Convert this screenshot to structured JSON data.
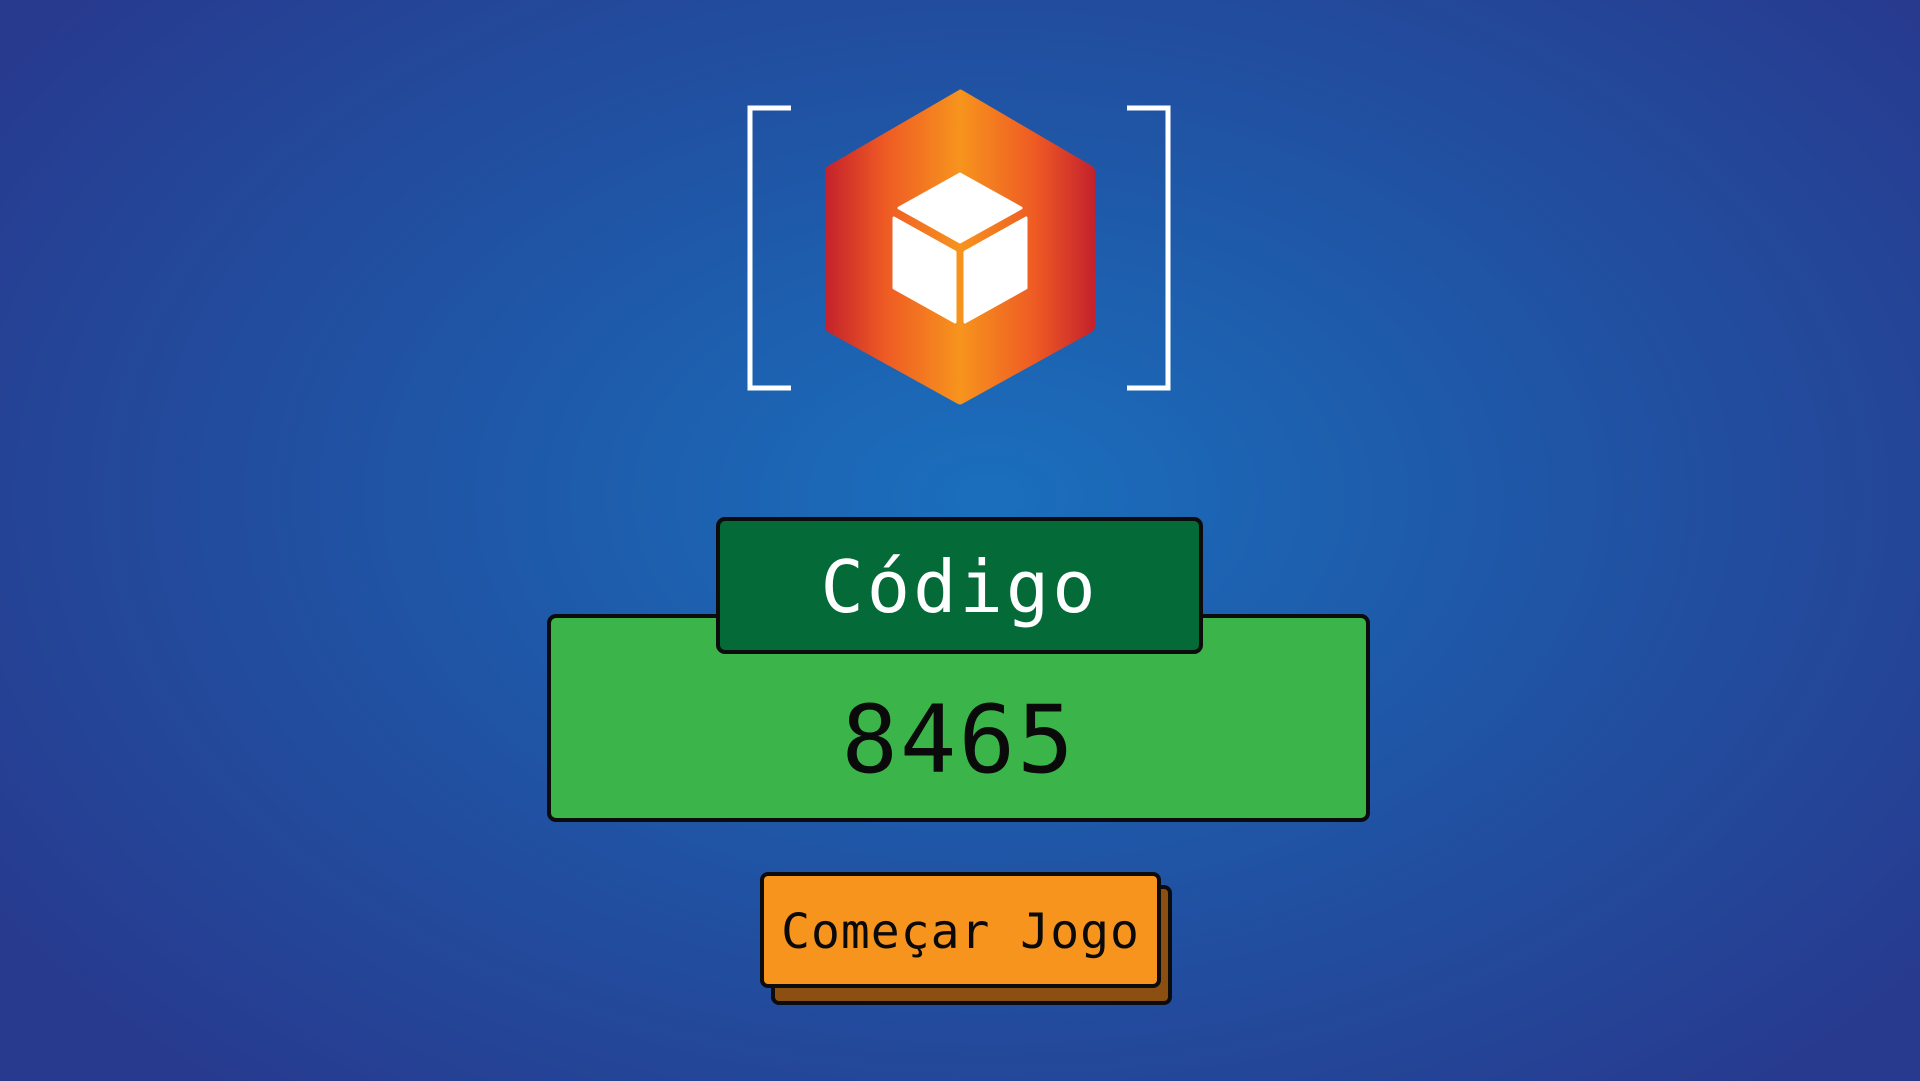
{
  "logo": {
    "icon": "cube-hexagon-icon",
    "colors": {
      "edge": "#c8232c",
      "mid": "#f26522",
      "center": "#f7941d",
      "cube": "#ffffff",
      "brackets": "#ffffff"
    }
  },
  "code": {
    "label": "Código",
    "value": "8465"
  },
  "start_button": {
    "label": "Começar Jogo"
  },
  "colors": {
    "background_center": "#1a6fbd",
    "background_edge": "#273a8e",
    "code_label_bg": "#046a38",
    "code_panel_bg": "#3bb54a",
    "button_bg": "#f7941d",
    "button_shadow": "#8c4f12"
  }
}
